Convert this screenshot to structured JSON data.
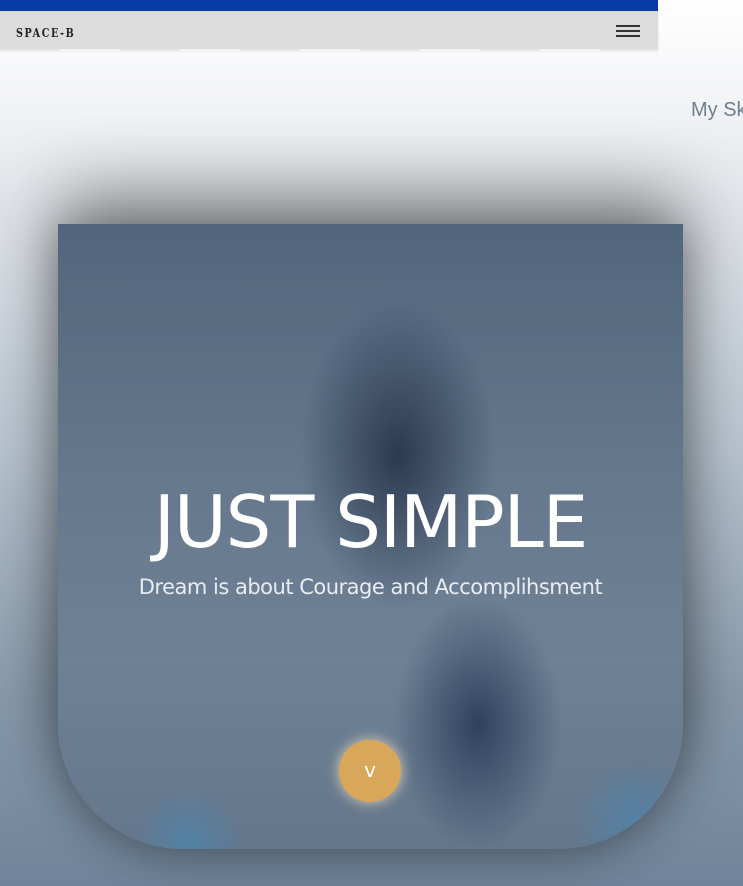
{
  "navbar": {
    "brand": "SPACE-B",
    "menu_icon": "hamburger-menu-icon"
  },
  "side_section": {
    "heading_partial": "My Sk"
  },
  "hero": {
    "title": "JUST SIMPLE",
    "subtitle": "Dream is about Courage and Accomplihsment",
    "scroll_button_label": "v",
    "accent_color": "#d9a75a"
  },
  "colors": {
    "topbar": "#0a3aa6",
    "navbar": "#dcdcdc"
  }
}
